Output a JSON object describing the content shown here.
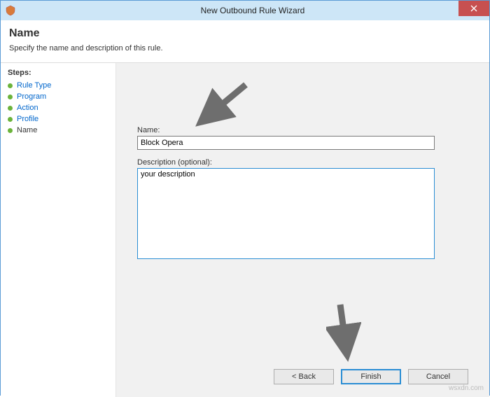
{
  "titlebar": {
    "title": "New Outbound Rule Wizard"
  },
  "header": {
    "title": "Name",
    "subtitle": "Specify the name and description of this rule."
  },
  "steps": {
    "header": "Steps:",
    "items": [
      {
        "label": "Rule Type"
      },
      {
        "label": "Program"
      },
      {
        "label": "Action"
      },
      {
        "label": "Profile"
      },
      {
        "label": "Name"
      }
    ]
  },
  "form": {
    "name_label": "Name:",
    "name_value": "Block Opera",
    "desc_label": "Description (optional):",
    "desc_value": "your description"
  },
  "buttons": {
    "back": "< Back",
    "finish": "Finish",
    "cancel": "Cancel"
  },
  "watermark": "wsxdn.com"
}
